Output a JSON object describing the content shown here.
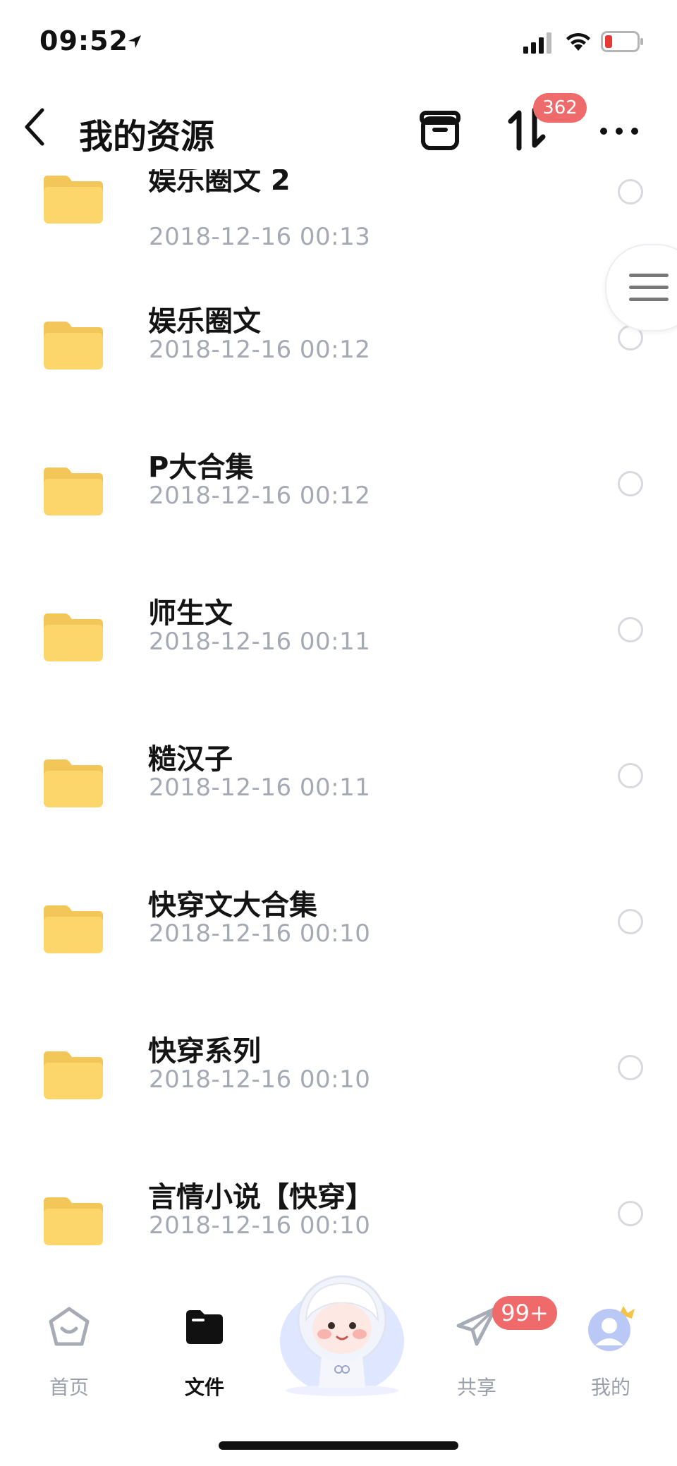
{
  "status_bar": {
    "time": "09:52"
  },
  "header": {
    "title": "我的资源",
    "badge": "362"
  },
  "files": [
    {
      "name": "娱乐圈文 2",
      "date": "2018-12-16 00:13"
    },
    {
      "name": "娱乐圈文",
      "date": "2018-12-16 00:12"
    },
    {
      "name": "P大合集",
      "date": "2018-12-16 00:12"
    },
    {
      "name": "师生文",
      "date": "2018-12-16 00:11"
    },
    {
      "name": "糙汉子",
      "date": "2018-12-16 00:11"
    },
    {
      "name": "快穿文大合集",
      "date": "2018-12-16 00:10"
    },
    {
      "name": "快穿系列",
      "date": "2018-12-16 00:10"
    },
    {
      "name": "言情小说【快穿】",
      "date": "2018-12-16 00:10"
    }
  ],
  "tabs": {
    "home": "首页",
    "files": "文件",
    "share": "共享",
    "share_badge": "99+",
    "mine": "我的"
  },
  "colors": {
    "folder": "#fcd66a",
    "badge": "#ef6b6b",
    "date_text": "#a4a9b4",
    "tab_inactive": "#9aa0aa"
  }
}
